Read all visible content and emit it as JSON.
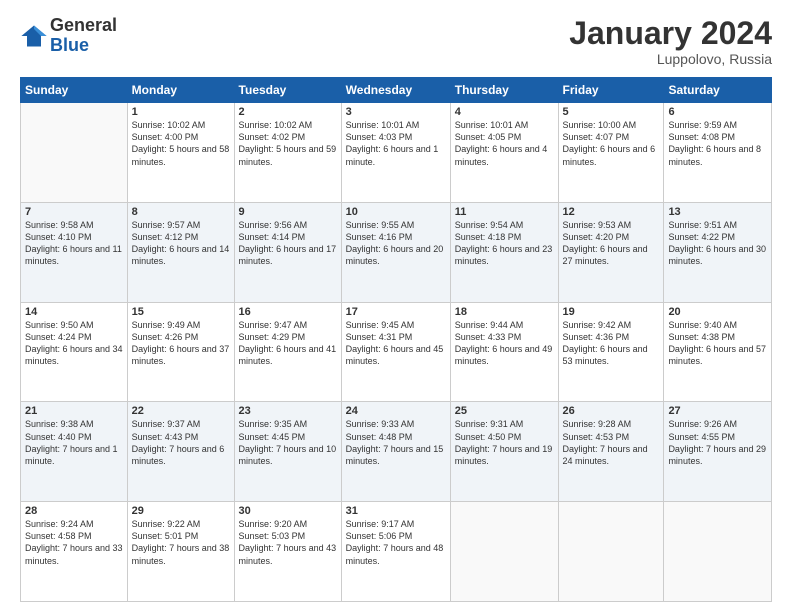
{
  "logo": {
    "general": "General",
    "blue": "Blue"
  },
  "title": "January 2024",
  "location": "Luppolovo, Russia",
  "weekdays": [
    "Sunday",
    "Monday",
    "Tuesday",
    "Wednesday",
    "Thursday",
    "Friday",
    "Saturday"
  ],
  "weeks": [
    [
      {
        "day": "",
        "sunrise": "",
        "sunset": "",
        "daylight": ""
      },
      {
        "day": "1",
        "sunrise": "Sunrise: 10:02 AM",
        "sunset": "Sunset: 4:00 PM",
        "daylight": "Daylight: 5 hours and 58 minutes."
      },
      {
        "day": "2",
        "sunrise": "Sunrise: 10:02 AM",
        "sunset": "Sunset: 4:02 PM",
        "daylight": "Daylight: 5 hours and 59 minutes."
      },
      {
        "day": "3",
        "sunrise": "Sunrise: 10:01 AM",
        "sunset": "Sunset: 4:03 PM",
        "daylight": "Daylight: 6 hours and 1 minute."
      },
      {
        "day": "4",
        "sunrise": "Sunrise: 10:01 AM",
        "sunset": "Sunset: 4:05 PM",
        "daylight": "Daylight: 6 hours and 4 minutes."
      },
      {
        "day": "5",
        "sunrise": "Sunrise: 10:00 AM",
        "sunset": "Sunset: 4:07 PM",
        "daylight": "Daylight: 6 hours and 6 minutes."
      },
      {
        "day": "6",
        "sunrise": "Sunrise: 9:59 AM",
        "sunset": "Sunset: 4:08 PM",
        "daylight": "Daylight: 6 hours and 8 minutes."
      }
    ],
    [
      {
        "day": "7",
        "sunrise": "Sunrise: 9:58 AM",
        "sunset": "Sunset: 4:10 PM",
        "daylight": "Daylight: 6 hours and 11 minutes."
      },
      {
        "day": "8",
        "sunrise": "Sunrise: 9:57 AM",
        "sunset": "Sunset: 4:12 PM",
        "daylight": "Daylight: 6 hours and 14 minutes."
      },
      {
        "day": "9",
        "sunrise": "Sunrise: 9:56 AM",
        "sunset": "Sunset: 4:14 PM",
        "daylight": "Daylight: 6 hours and 17 minutes."
      },
      {
        "day": "10",
        "sunrise": "Sunrise: 9:55 AM",
        "sunset": "Sunset: 4:16 PM",
        "daylight": "Daylight: 6 hours and 20 minutes."
      },
      {
        "day": "11",
        "sunrise": "Sunrise: 9:54 AM",
        "sunset": "Sunset: 4:18 PM",
        "daylight": "Daylight: 6 hours and 23 minutes."
      },
      {
        "day": "12",
        "sunrise": "Sunrise: 9:53 AM",
        "sunset": "Sunset: 4:20 PM",
        "daylight": "Daylight: 6 hours and 27 minutes."
      },
      {
        "day": "13",
        "sunrise": "Sunrise: 9:51 AM",
        "sunset": "Sunset: 4:22 PM",
        "daylight": "Daylight: 6 hours and 30 minutes."
      }
    ],
    [
      {
        "day": "14",
        "sunrise": "Sunrise: 9:50 AM",
        "sunset": "Sunset: 4:24 PM",
        "daylight": "Daylight: 6 hours and 34 minutes."
      },
      {
        "day": "15",
        "sunrise": "Sunrise: 9:49 AM",
        "sunset": "Sunset: 4:26 PM",
        "daylight": "Daylight: 6 hours and 37 minutes."
      },
      {
        "day": "16",
        "sunrise": "Sunrise: 9:47 AM",
        "sunset": "Sunset: 4:29 PM",
        "daylight": "Daylight: 6 hours and 41 minutes."
      },
      {
        "day": "17",
        "sunrise": "Sunrise: 9:45 AM",
        "sunset": "Sunset: 4:31 PM",
        "daylight": "Daylight: 6 hours and 45 minutes."
      },
      {
        "day": "18",
        "sunrise": "Sunrise: 9:44 AM",
        "sunset": "Sunset: 4:33 PM",
        "daylight": "Daylight: 6 hours and 49 minutes."
      },
      {
        "day": "19",
        "sunrise": "Sunrise: 9:42 AM",
        "sunset": "Sunset: 4:36 PM",
        "daylight": "Daylight: 6 hours and 53 minutes."
      },
      {
        "day": "20",
        "sunrise": "Sunrise: 9:40 AM",
        "sunset": "Sunset: 4:38 PM",
        "daylight": "Daylight: 6 hours and 57 minutes."
      }
    ],
    [
      {
        "day": "21",
        "sunrise": "Sunrise: 9:38 AM",
        "sunset": "Sunset: 4:40 PM",
        "daylight": "Daylight: 7 hours and 1 minute."
      },
      {
        "day": "22",
        "sunrise": "Sunrise: 9:37 AM",
        "sunset": "Sunset: 4:43 PM",
        "daylight": "Daylight: 7 hours and 6 minutes."
      },
      {
        "day": "23",
        "sunrise": "Sunrise: 9:35 AM",
        "sunset": "Sunset: 4:45 PM",
        "daylight": "Daylight: 7 hours and 10 minutes."
      },
      {
        "day": "24",
        "sunrise": "Sunrise: 9:33 AM",
        "sunset": "Sunset: 4:48 PM",
        "daylight": "Daylight: 7 hours and 15 minutes."
      },
      {
        "day": "25",
        "sunrise": "Sunrise: 9:31 AM",
        "sunset": "Sunset: 4:50 PM",
        "daylight": "Daylight: 7 hours and 19 minutes."
      },
      {
        "day": "26",
        "sunrise": "Sunrise: 9:28 AM",
        "sunset": "Sunset: 4:53 PM",
        "daylight": "Daylight: 7 hours and 24 minutes."
      },
      {
        "day": "27",
        "sunrise": "Sunrise: 9:26 AM",
        "sunset": "Sunset: 4:55 PM",
        "daylight": "Daylight: 7 hours and 29 minutes."
      }
    ],
    [
      {
        "day": "28",
        "sunrise": "Sunrise: 9:24 AM",
        "sunset": "Sunset: 4:58 PM",
        "daylight": "Daylight: 7 hours and 33 minutes."
      },
      {
        "day": "29",
        "sunrise": "Sunrise: 9:22 AM",
        "sunset": "Sunset: 5:01 PM",
        "daylight": "Daylight: 7 hours and 38 minutes."
      },
      {
        "day": "30",
        "sunrise": "Sunrise: 9:20 AM",
        "sunset": "Sunset: 5:03 PM",
        "daylight": "Daylight: 7 hours and 43 minutes."
      },
      {
        "day": "31",
        "sunrise": "Sunrise: 9:17 AM",
        "sunset": "Sunset: 5:06 PM",
        "daylight": "Daylight: 7 hours and 48 minutes."
      },
      {
        "day": "",
        "sunrise": "",
        "sunset": "",
        "daylight": ""
      },
      {
        "day": "",
        "sunrise": "",
        "sunset": "",
        "daylight": ""
      },
      {
        "day": "",
        "sunrise": "",
        "sunset": "",
        "daylight": ""
      }
    ]
  ]
}
